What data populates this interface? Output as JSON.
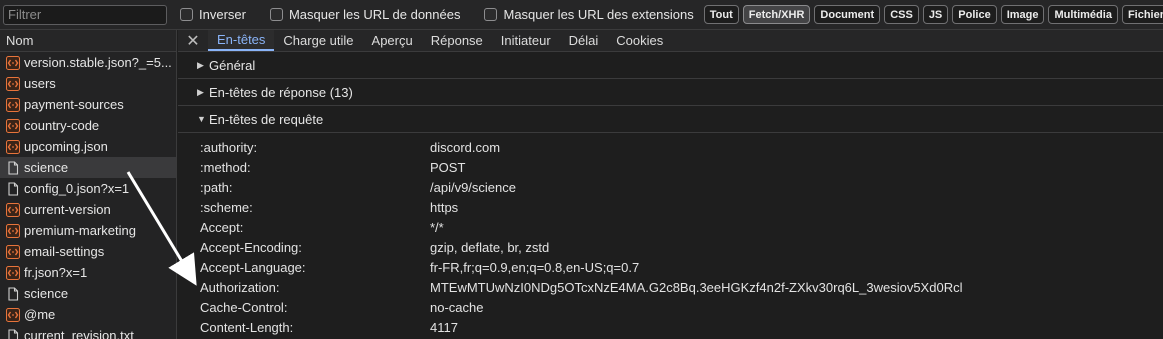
{
  "toolbar": {
    "filter_placeholder": "Filtrer",
    "invert_label": "Inverser",
    "hide_data_urls_label": "Masquer les URL de données",
    "hide_extension_urls_label": "Masquer les URL des extensions",
    "type_chips": [
      "Tout",
      "Fetch/XHR",
      "Document",
      "CSS",
      "JS",
      "Police",
      "Image",
      "Multimédia",
      "Fichier m"
    ],
    "active_chip": "Fetch/XHR"
  },
  "request_list": {
    "header": "Nom",
    "rows": [
      {
        "label": "version.stable.json?_=5...",
        "icon": "xhr-icon"
      },
      {
        "label": "users",
        "icon": "xhr-icon"
      },
      {
        "label": "payment-sources",
        "icon": "xhr-icon"
      },
      {
        "label": "country-code",
        "icon": "xhr-icon"
      },
      {
        "label": "upcoming.json",
        "icon": "xhr-icon"
      },
      {
        "label": "science",
        "icon": "document-icon",
        "selected": true
      },
      {
        "label": "config_0.json?x=1",
        "icon": "document-icon"
      },
      {
        "label": "current-version",
        "icon": "xhr-icon"
      },
      {
        "label": "premium-marketing",
        "icon": "xhr-icon"
      },
      {
        "label": "email-settings",
        "icon": "xhr-icon"
      },
      {
        "label": "fr.json?x=1",
        "icon": "xhr-icon"
      },
      {
        "label": "science",
        "icon": "document-icon"
      },
      {
        "label": "@me",
        "icon": "xhr-icon"
      },
      {
        "label": "current_revision.txt",
        "icon": "document-icon"
      }
    ]
  },
  "details": {
    "close_glyph": "✕",
    "tabs": [
      "En-têtes",
      "Charge utile",
      "Aperçu",
      "Réponse",
      "Initiateur",
      "Délai",
      "Cookies"
    ],
    "active_tab": "En-têtes",
    "sections": {
      "general": "Général",
      "response_headers": "En-têtes de réponse (13)",
      "request_headers": "En-têtes de requête"
    },
    "request_headers": [
      {
        "name": ":authority:",
        "value": "discord.com"
      },
      {
        "name": ":method:",
        "value": "POST"
      },
      {
        "name": ":path:",
        "value": "/api/v9/science"
      },
      {
        "name": ":scheme:",
        "value": "https"
      },
      {
        "name": "Accept:",
        "value": "*/*"
      },
      {
        "name": "Accept-Encoding:",
        "value": "gzip, deflate, br, zstd"
      },
      {
        "name": "Accept-Language:",
        "value": "fr-FR,fr;q=0.9,en;q=0.8,en-US;q=0.7"
      },
      {
        "name": "Authorization:",
        "value": "MTEwMTUwNzI0NDg5OTcxNzE4MA.G2c8Bq.3eeHGKzf4n2f-ZXkv30rq6L_3wesiov5Xd0Rcl"
      },
      {
        "name": "Cache-Control:",
        "value": "no-cache"
      },
      {
        "name": "Content-Length:",
        "value": "4117"
      }
    ]
  },
  "colors": {
    "background": "#1e1e1e",
    "panel": "#262627",
    "selected_row": "#3a3a3c",
    "active_tab": "#8ab4f8",
    "xhr_icon": "#e8743b",
    "annotation_arrow": "#ffffff"
  }
}
